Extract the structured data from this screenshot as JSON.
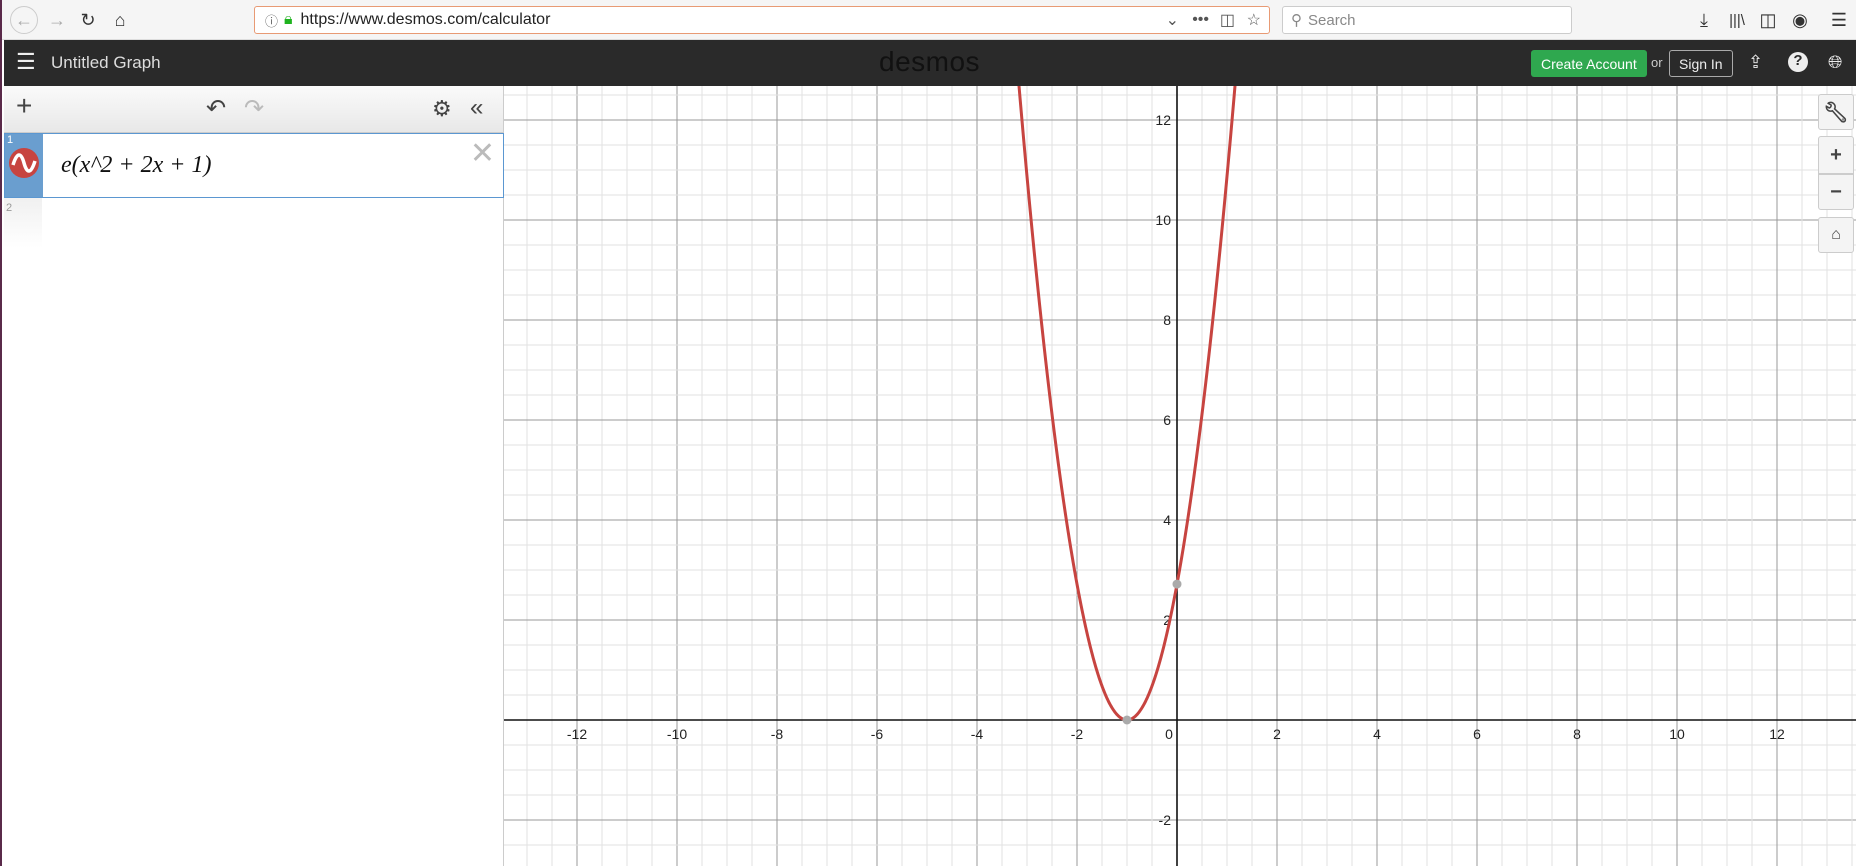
{
  "browser": {
    "url": "https://www.desmos.com/calculator",
    "search_placeholder": "Search"
  },
  "header": {
    "title": "Untitled Graph",
    "logo": "desmos",
    "create_account": "Create Account",
    "or": "or",
    "sign_in": "Sign In"
  },
  "expressions": [
    {
      "index": "1",
      "latex": "e(x^2 + 2x + 1)",
      "color": "#c74440"
    },
    {
      "index": "2",
      "latex": ""
    }
  ],
  "graph": {
    "xlim": [
      -13.5,
      13.5
    ],
    "ylim": [
      -2.9,
      12.7
    ],
    "x_ticks": [
      -12,
      -10,
      -8,
      -6,
      -4,
      -2,
      0,
      2,
      4,
      6,
      8,
      10,
      12
    ],
    "y_ticks": [
      -2,
      2,
      4,
      6,
      8,
      10,
      12
    ],
    "curve_color": "#c74440",
    "points": [
      [
        -1,
        0
      ],
      [
        0,
        2.718
      ]
    ]
  }
}
